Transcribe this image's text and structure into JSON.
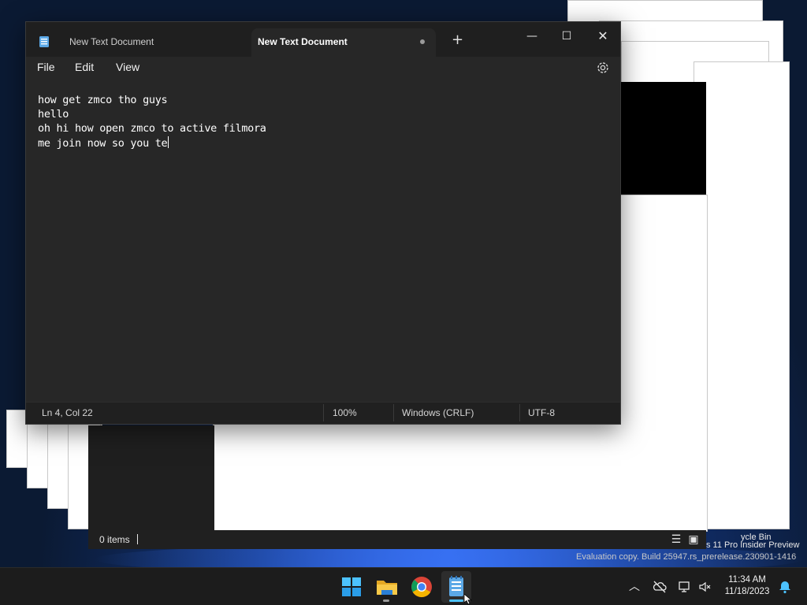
{
  "notepad": {
    "tabs": [
      {
        "label": "New Text Document",
        "active": false
      },
      {
        "label": "New Text Document",
        "active": true,
        "unsaved": true
      }
    ],
    "window_controls": {
      "minimize": "—",
      "maximize": "☐",
      "close": "✕"
    },
    "menu": {
      "file": "File",
      "edit": "Edit",
      "view": "View"
    },
    "lines": [
      "how get zmco tho guys",
      "hello",
      "oh hi how open zmco to active filmora",
      "me join now so you te"
    ],
    "status": {
      "position": "Ln 4, Col 22",
      "zoom": "100%",
      "line_ending": "Windows (CRLF)",
      "encoding": "UTF-8"
    }
  },
  "explorer": {
    "item_count": "0 items"
  },
  "desktop": {
    "recycle_bin_label": "ycle Bin",
    "watermark_line1": "s 11 Pro Insider Preview",
    "watermark_line2": "Evaluation copy. Build 25947.rs_prerelease.230901-1416"
  },
  "taskbar": {
    "apps": [
      "start-icon",
      "file-explorer-icon",
      "chrome-icon",
      "notepad-icon"
    ],
    "clock_time": "11:34 AM",
    "clock_date": "11/18/2023"
  },
  "colors": {
    "accent": "#4cc2ff",
    "notepad_bg": "#272727",
    "titlebar_bg": "#1f1f1f"
  }
}
